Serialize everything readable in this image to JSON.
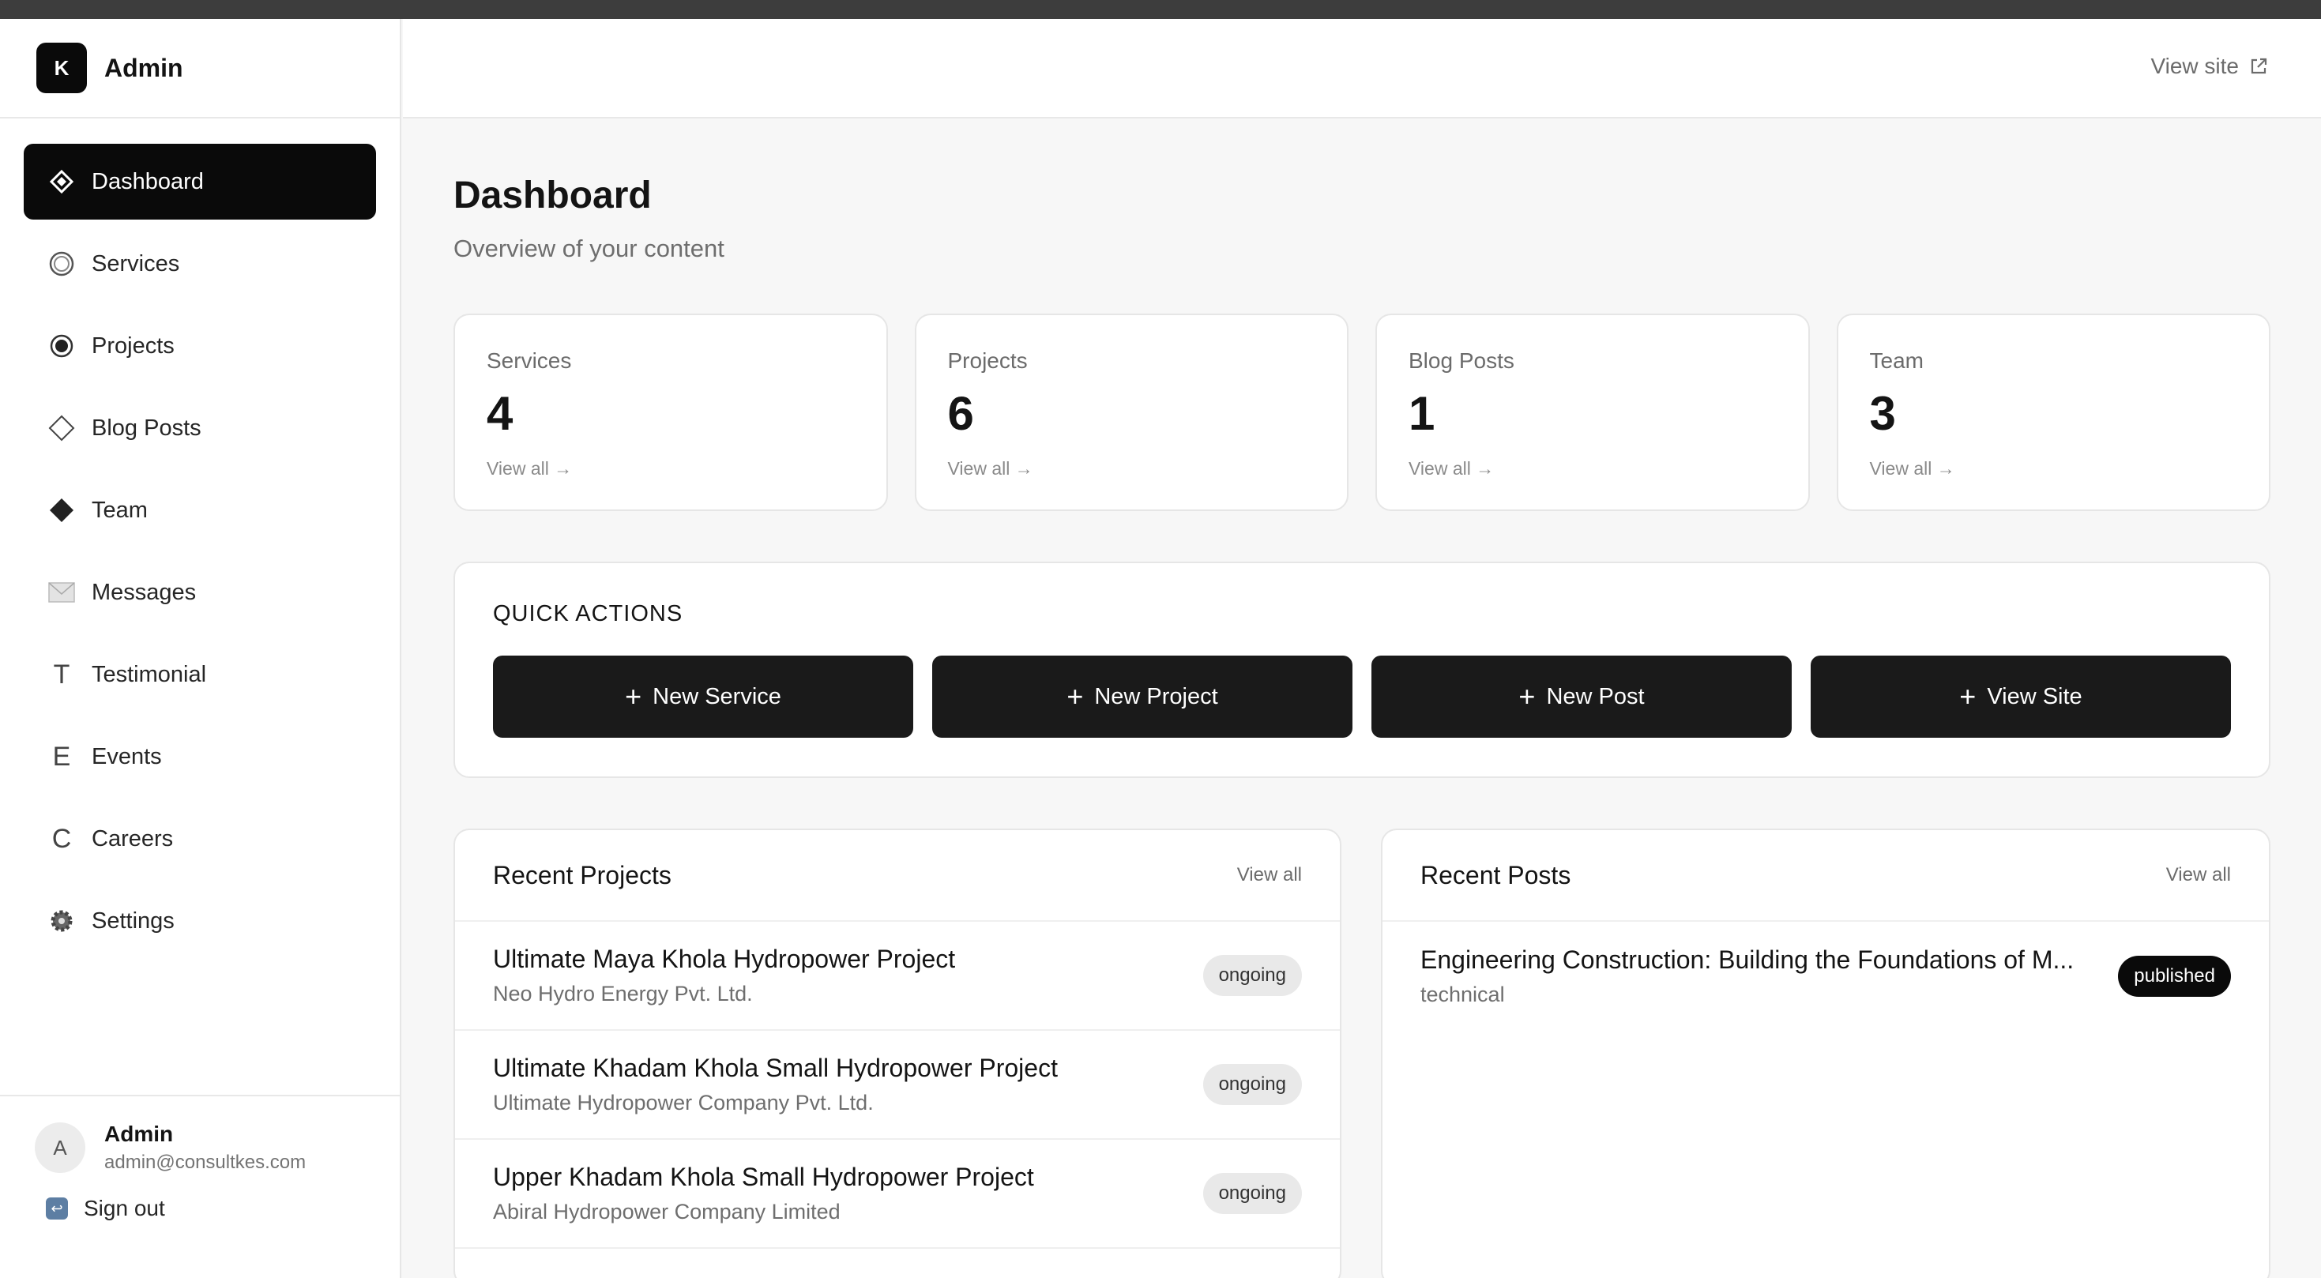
{
  "brand": {
    "logo_letter": "K",
    "name": "Admin"
  },
  "nav": [
    {
      "label": "Dashboard",
      "icon": "dashboard-diamond-icon"
    },
    {
      "label": "Services",
      "icon": "ring-icon"
    },
    {
      "label": "Projects",
      "icon": "dot-circle-icon"
    },
    {
      "label": "Blog Posts",
      "icon": "diamond-outline-icon"
    },
    {
      "label": "Team",
      "icon": "diamond-filled-icon"
    },
    {
      "label": "Messages",
      "icon": "envelope-icon"
    },
    {
      "label": "Testimonial",
      "icon": "T"
    },
    {
      "label": "Events",
      "icon": "E"
    },
    {
      "label": "Careers",
      "icon": "C"
    },
    {
      "label": "Settings",
      "icon": "gear-icon"
    }
  ],
  "user": {
    "avatar_letter": "A",
    "name": "Admin",
    "email": "admin@consultkes.com",
    "signout_label": "Sign out"
  },
  "header": {
    "view_site_label": "View site"
  },
  "page": {
    "title": "Dashboard",
    "subtitle": "Overview of your content"
  },
  "stats": [
    {
      "label": "Services",
      "value": "4",
      "link": "View all →"
    },
    {
      "label": "Projects",
      "value": "6",
      "link": "View all →"
    },
    {
      "label": "Blog Posts",
      "value": "1",
      "link": "View all →"
    },
    {
      "label": "Team",
      "value": "3",
      "link": "View all →"
    }
  ],
  "quick_actions": {
    "title": "QUICK ACTIONS",
    "buttons": [
      "New Service",
      "New Project",
      "New Post",
      "View Site"
    ]
  },
  "recent_projects": {
    "title": "Recent Projects",
    "view_all": "View all",
    "items": [
      {
        "title": "Ultimate Maya Khola Hydropower Project",
        "subtitle": "Neo Hydro Energy Pvt. Ltd.",
        "status": "ongoing"
      },
      {
        "title": "Ultimate Khadam Khola Small Hydropower Project",
        "subtitle": "Ultimate Hydropower Company Pvt. Ltd.",
        "status": "ongoing"
      },
      {
        "title": "Upper Khadam Khola Small Hydropower Project",
        "subtitle": "Abiral Hydropower Company Limited",
        "status": "ongoing"
      }
    ]
  },
  "recent_posts": {
    "title": "Recent Posts",
    "view_all": "View all",
    "items": [
      {
        "title": "Engineering Construction: Building the Foundations of M...",
        "subtitle": "technical",
        "status": "published"
      }
    ]
  },
  "colors": {
    "accent": "#0a0a0a",
    "background": "#f7f7f7",
    "badge_gray": "#e9e9e9"
  }
}
